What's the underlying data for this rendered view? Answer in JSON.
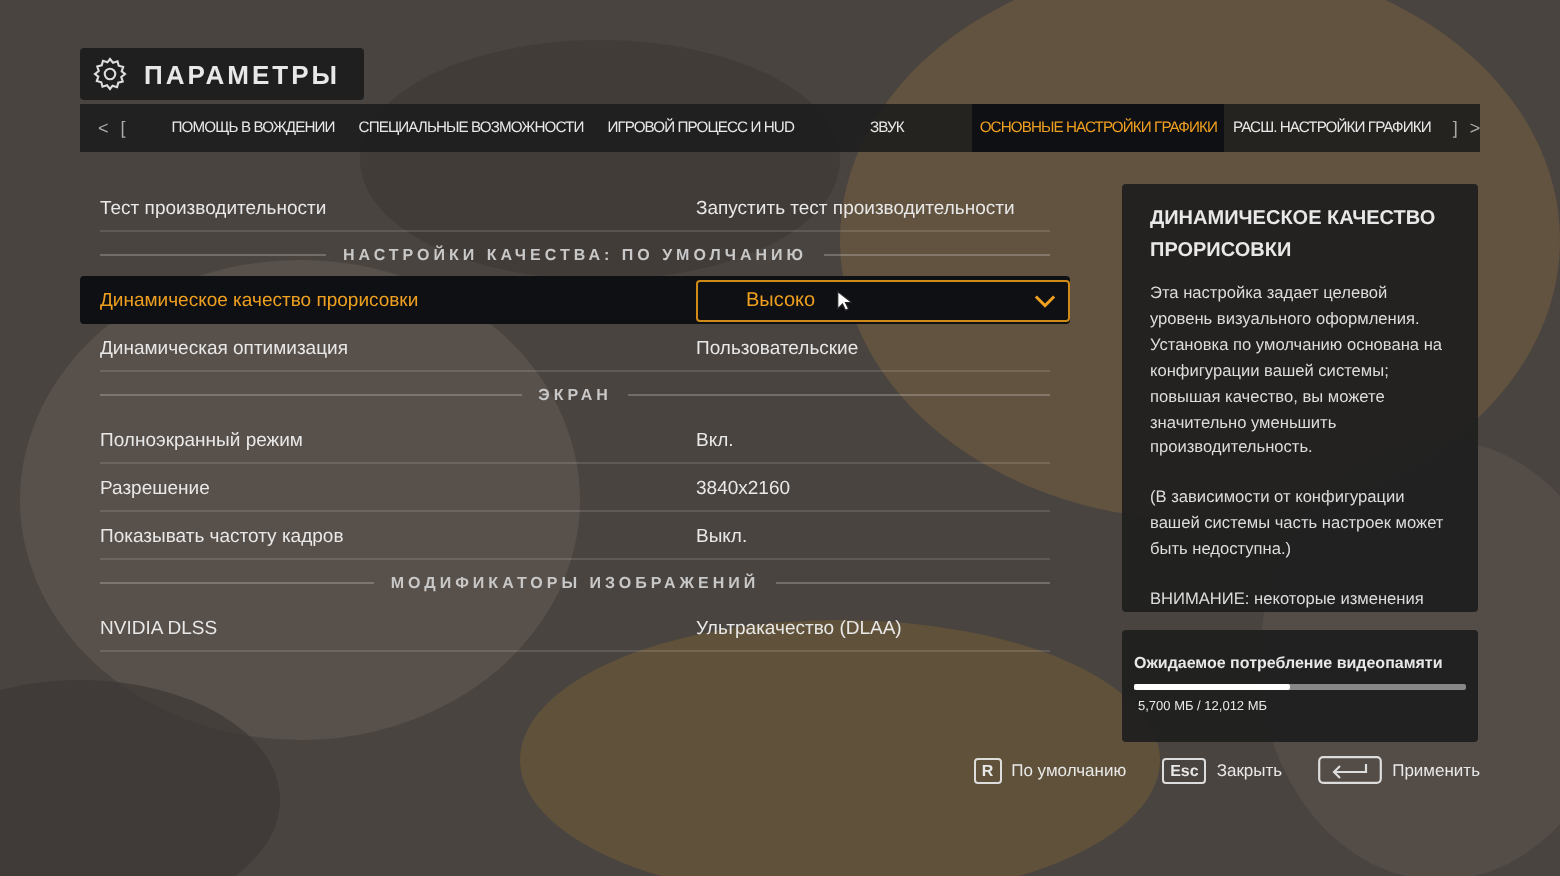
{
  "header": {
    "title": "ПАРАМЕТРЫ"
  },
  "tabs": {
    "prev": "<",
    "left_bracket": "[",
    "right_bracket": "]",
    "next": ">",
    "items": [
      {
        "label": "ПОМОЩЬ В ВОЖДЕНИИ",
        "selected": false
      },
      {
        "label": "СПЕЦИАЛЬНЫЕ ВОЗМОЖНОСТИ",
        "selected": false
      },
      {
        "label": "ИГРОВОЙ ПРОЦЕСС И HUD",
        "selected": false
      },
      {
        "label": "ЗВУК",
        "selected": false
      },
      {
        "label": "ОСНОВНЫЕ НАСТРОЙКИ ГРАФИКИ",
        "selected": true
      },
      {
        "label": "РАСШ. НАСТРОЙКИ ГРАФИКИ",
        "selected": false
      }
    ]
  },
  "settings": [
    {
      "kind": "row",
      "label": "Тест производительности",
      "value": "Запустить тест производительности",
      "selected": false
    },
    {
      "kind": "header",
      "label": "НАСТРОЙКИ КАЧЕСТВА: ПО УМОЛЧАНИЮ"
    },
    {
      "kind": "dropdown",
      "label": "Динамическое качество прорисовки",
      "value": "Высоко",
      "selected": true
    },
    {
      "kind": "row",
      "label": "Динамическая оптимизация",
      "value": "Пользовательские",
      "selected": false
    },
    {
      "kind": "header",
      "label": "ЭКРАН"
    },
    {
      "kind": "row",
      "label": "Полноэкранный режим",
      "value": "Вкл.",
      "selected": false
    },
    {
      "kind": "row",
      "label": "Разрешение",
      "value": "3840x2160",
      "selected": false
    },
    {
      "kind": "row",
      "label": "Показывать частоту кадров",
      "value": "Выкл.",
      "selected": false
    },
    {
      "kind": "header",
      "label": "МОДИФИКАТОРЫ ИЗОБРАЖЕНИЙ"
    },
    {
      "kind": "row",
      "label": "NVIDIA DLSS",
      "value": "Ультракачество (DLAA)",
      "selected": false
    }
  ],
  "info": {
    "title": "ДИНАМИЧЕСКОЕ КАЧЕСТВО ПРОРИСОВКИ",
    "paragraphs": [
      "Эта настройка задает целевой уровень визуального оформления. Установка по умолчанию основана на конфигурации вашей системы; повышая качество, вы можете значительно уменьшить производительность.",
      "(В зависимости от конфигурации вашей системы часть настроек может быть недоступна.)",
      "ВНИМАНИЕ: некоторые изменения"
    ]
  },
  "memory": {
    "title": "Ожидаемое потребление видеопамяти",
    "level": 0.47,
    "reading": "5,700 МБ / 12,012 МБ"
  },
  "footer": [
    {
      "kind": "key",
      "key": "R",
      "label": "По умолчанию"
    },
    {
      "kind": "key",
      "key": "Esc",
      "label": "Закрыть"
    },
    {
      "kind": "enter",
      "label": "Применить"
    }
  ]
}
